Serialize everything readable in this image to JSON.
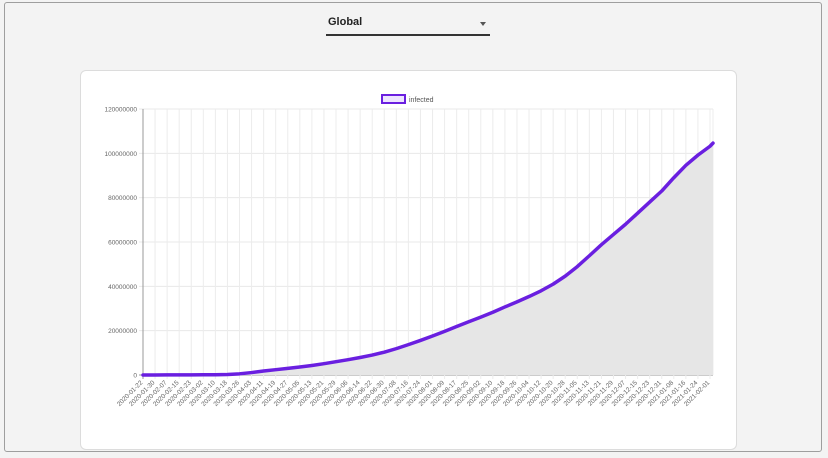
{
  "selector": {
    "value": "Global"
  },
  "chart_data": {
    "type": "area",
    "title": "",
    "xlabel": "",
    "ylabel": "",
    "ylim": [
      0,
      120000000
    ],
    "yticks": [
      0,
      20000000,
      40000000,
      60000000,
      80000000,
      100000000,
      120000000
    ],
    "legend": {
      "placement": "top",
      "label": "infected"
    },
    "grid": true,
    "colors": {
      "line": "#6a1fe0",
      "fill": "#e6e6e6"
    },
    "x_tick_labels": [
      "2020-01-22",
      "2020-01-30",
      "2020-02-07",
      "2020-02-15",
      "2020-02-23",
      "2020-03-02",
      "2020-03-10",
      "2020-03-18",
      "2020-03-26",
      "2020-04-03",
      "2020-04-11",
      "2020-04-19",
      "2020-04-27",
      "2020-05-05",
      "2020-05-13",
      "2020-05-21",
      "2020-05-29",
      "2020-06-06",
      "2020-06-14",
      "2020-06-22",
      "2020-06-30",
      "2020-07-08",
      "2020-07-16",
      "2020-07-24",
      "2020-08-01",
      "2020-08-09",
      "2020-08-17",
      "2020-08-25",
      "2020-09-02",
      "2020-09-10",
      "2020-09-18",
      "2020-09-26",
      "2020-10-04",
      "2020-10-12",
      "2020-10-20",
      "2020-10-28",
      "2020-11-05",
      "2020-11-13",
      "2020-11-21",
      "2020-11-29",
      "2020-12-07",
      "2020-12-15",
      "2020-12-23",
      "2020-12-31",
      "2021-01-08",
      "2021-01-16",
      "2021-01-24",
      "2021-02-01"
    ],
    "series": [
      {
        "name": "infected",
        "x": [
          "2020-01-22",
          "2020-01-30",
          "2020-02-07",
          "2020-02-15",
          "2020-02-23",
          "2020-03-02",
          "2020-03-10",
          "2020-03-18",
          "2020-03-26",
          "2020-04-03",
          "2020-04-11",
          "2020-04-19",
          "2020-04-27",
          "2020-05-05",
          "2020-05-13",
          "2020-05-21",
          "2020-05-29",
          "2020-06-06",
          "2020-06-14",
          "2020-06-22",
          "2020-06-30",
          "2020-07-08",
          "2020-07-16",
          "2020-07-24",
          "2020-08-01",
          "2020-08-09",
          "2020-08-17",
          "2020-08-25",
          "2020-09-02",
          "2020-09-10",
          "2020-09-18",
          "2020-09-26",
          "2020-10-04",
          "2020-10-12",
          "2020-10-20",
          "2020-10-28",
          "2020-11-05",
          "2020-11-13",
          "2020-11-21",
          "2020-11-29",
          "2020-12-07",
          "2020-12-15",
          "2020-12-23",
          "2020-12-31",
          "2021-01-08",
          "2021-01-16",
          "2021-01-24",
          "2021-02-01",
          "2021-02-03"
        ],
        "values": [
          600,
          9800,
          34000,
          50000,
          79000,
          90000,
          119000,
          214000,
          532000,
          1100000,
          1800000,
          2400000,
          3000000,
          3600000,
          4300000,
          5100000,
          6000000,
          6900000,
          7900000,
          9000000,
          10300000,
          11900000,
          13700000,
          15600000,
          17600000,
          19700000,
          21900000,
          24000000,
          26100000,
          28300000,
          30700000,
          33000000,
          35400000,
          38000000,
          41000000,
          44600000,
          48900000,
          53800000,
          58800000,
          63400000,
          68000000,
          73000000,
          78000000,
          83000000,
          89000000,
          94600000,
          99200000,
          103200000,
          104600000
        ]
      }
    ]
  }
}
